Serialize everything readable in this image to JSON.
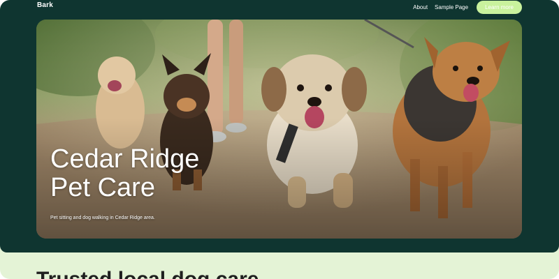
{
  "brand": "Bark",
  "nav": {
    "links": [
      "About",
      "Sample Page"
    ],
    "cta_label": "Learn more"
  },
  "hero": {
    "title_line1": "Cedar Ridge",
    "title_line2": "Pet Care",
    "subtitle": "Pet sitting and dog walking in Cedar Ridge area.",
    "image_subject": "dogs-walking-on-park-path"
  },
  "section": {
    "heading": "Trusted local dog care"
  },
  "colors": {
    "background_dark": "#0f3530",
    "accent": "#c9f29d",
    "page_background": "#e4f3d6"
  }
}
